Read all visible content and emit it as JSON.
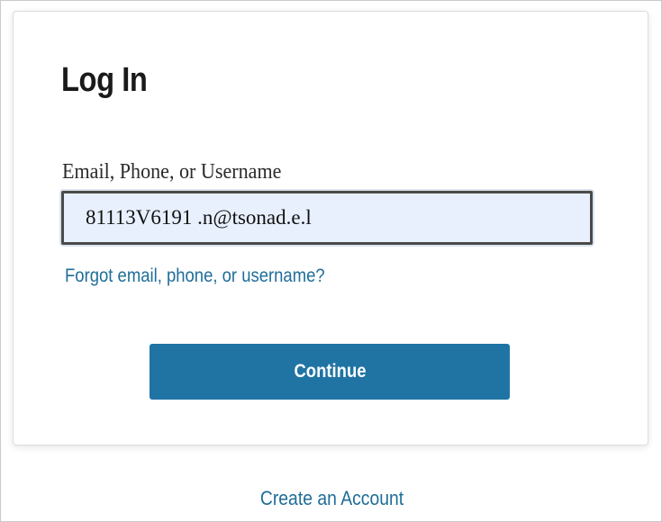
{
  "login": {
    "title": "Log In",
    "field_label": "Email, Phone, or Username",
    "field_value": "81113V6191 .n@tsonad.e.l",
    "forgot_link": "Forgot email, phone, or username?",
    "continue_label": "Continue"
  },
  "footer": {
    "create_account_link": "Create an Account"
  },
  "colors": {
    "accent": "#1f74a4",
    "link": "#1f6e99",
    "input_background": "#e8f0fe",
    "text": "#1a1a1a"
  }
}
